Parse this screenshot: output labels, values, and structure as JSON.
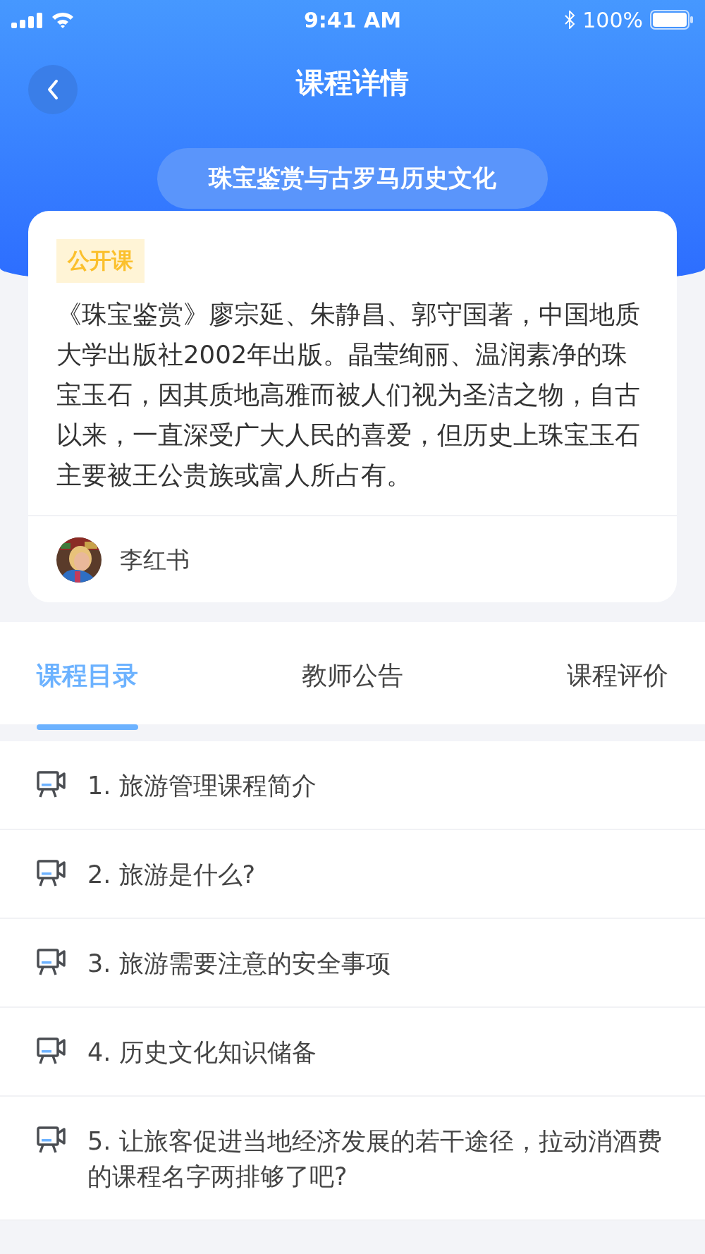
{
  "status_bar": {
    "time": "9:41 AM",
    "battery": "100%"
  },
  "nav": {
    "title": "课程详情"
  },
  "course": {
    "name": "珠宝鉴赏与古罗马历史文化",
    "tag": "公开课",
    "description": "《珠宝鉴赏》廖宗延、朱静昌、郭守国著，中国地质大学出版社2002年出版。晶莹绚丽、温润素净的珠宝玉石，因其质地高雅而被人们视为圣洁之物，自古以来，一直深受广大人民的喜爱，但历史上珠宝玉石主要被王公贵族或富人所占有。",
    "teacher": "李红书"
  },
  "tabs": [
    {
      "label": "课程目录",
      "selected": true
    },
    {
      "label": "教师公告",
      "selected": false
    },
    {
      "label": "课程评价",
      "selected": false
    }
  ],
  "lessons": [
    {
      "title": "1. 旅游管理课程简介"
    },
    {
      "title": "2. 旅游是什么?"
    },
    {
      "title": "3. 旅游需要注意的安全事项"
    },
    {
      "title": "4. 历史文化知识储备"
    },
    {
      "title": "5. 让旅客促进当地经济发展的若干途径，拉动消酒费的课程名字两排够了吧?"
    }
  ]
}
